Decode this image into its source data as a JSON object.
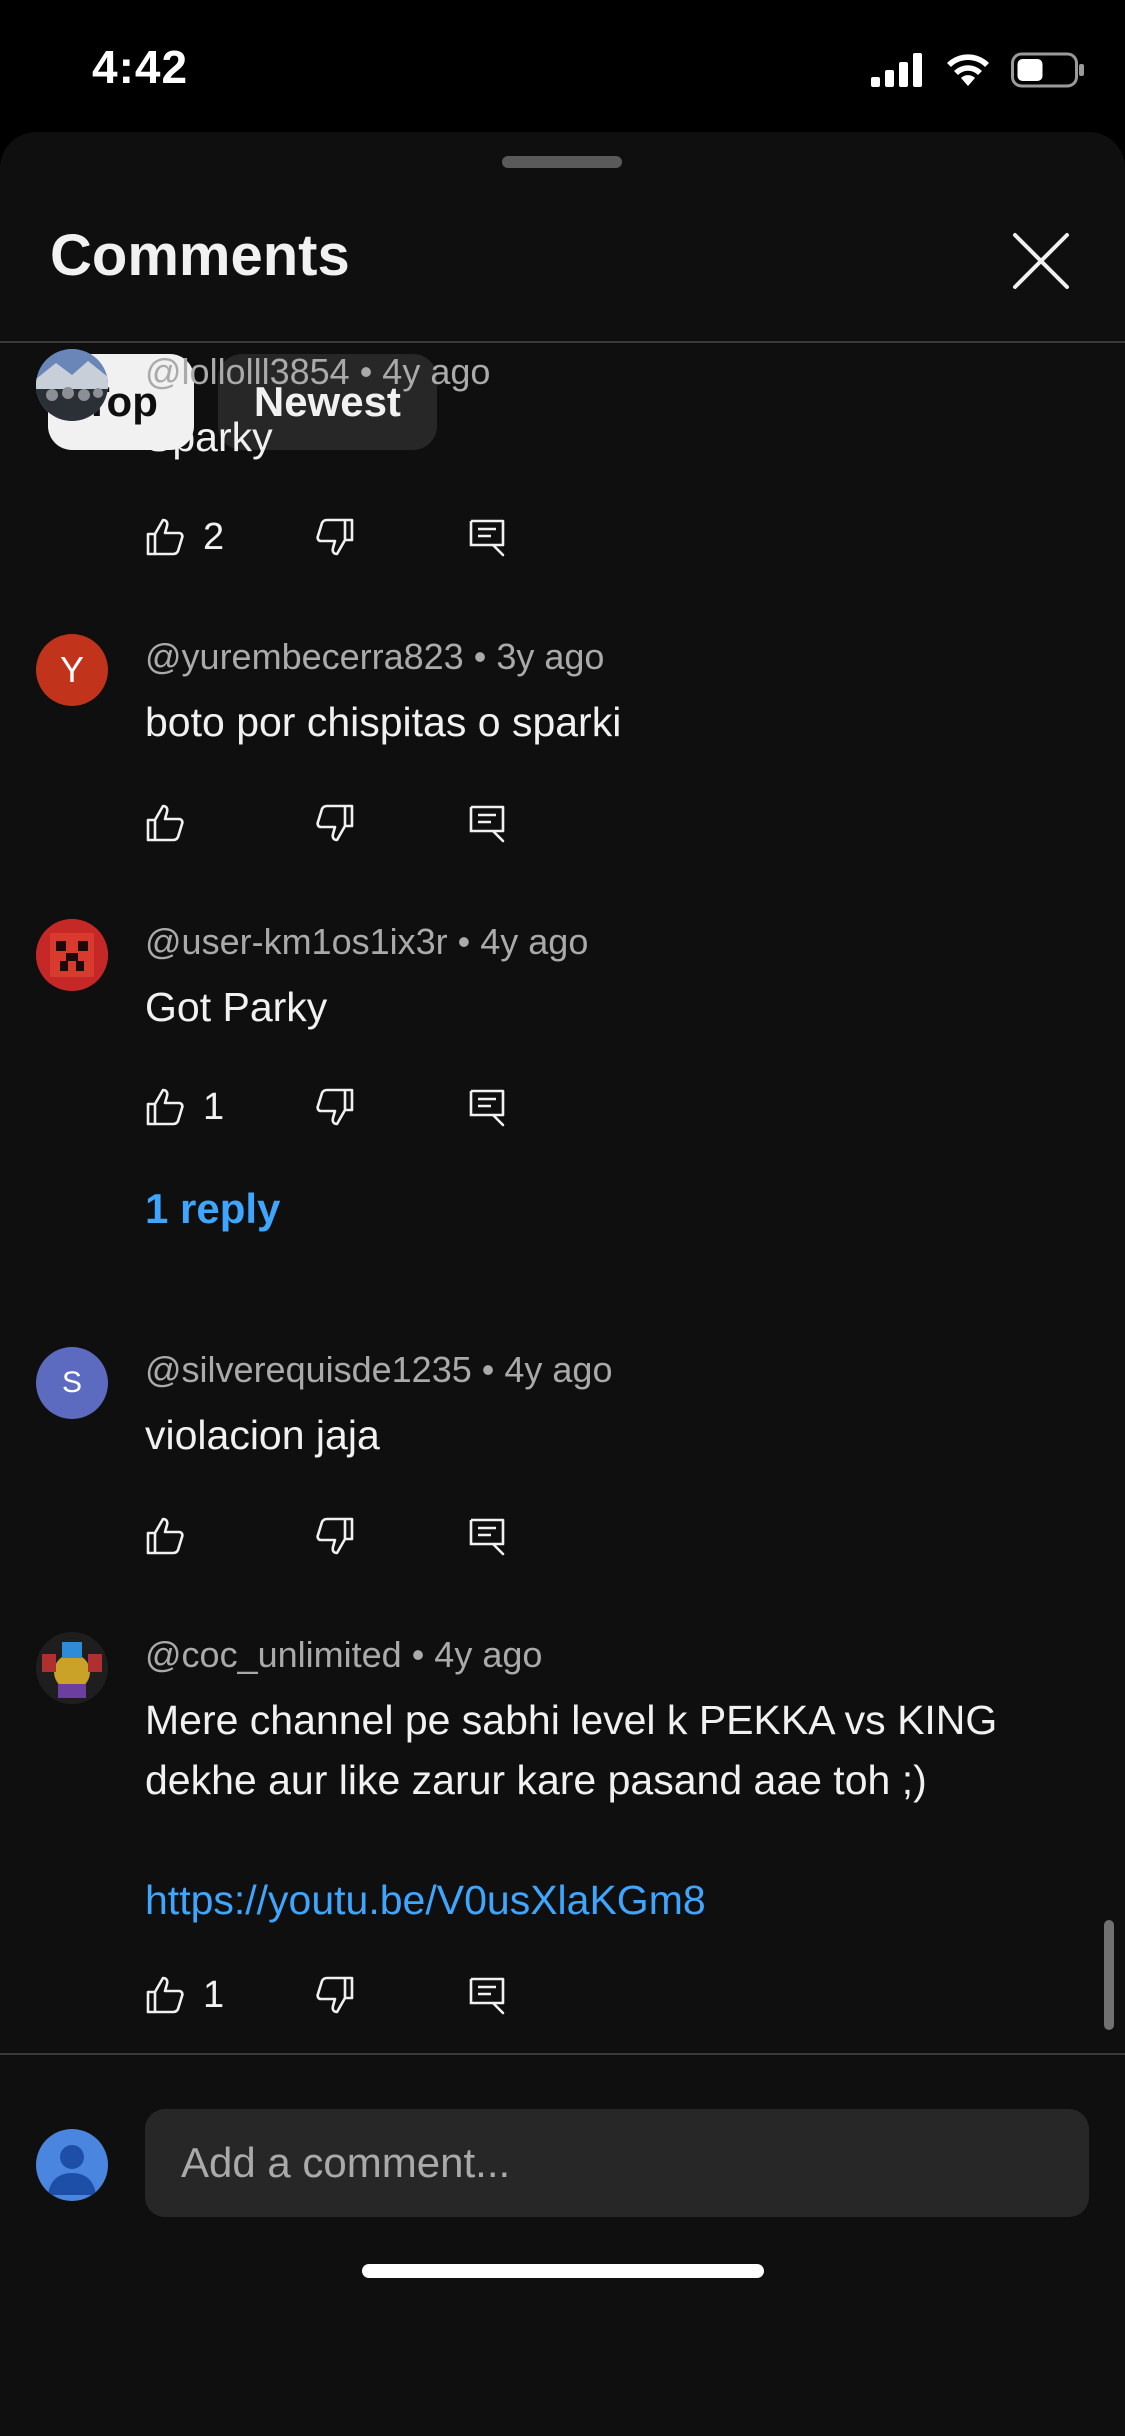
{
  "status": {
    "time": "4:42"
  },
  "sheet": {
    "title": "Comments",
    "tabs": [
      {
        "label": "Top",
        "active": true
      },
      {
        "label": "Newest",
        "active": false
      }
    ]
  },
  "comments": [
    {
      "handle": "@lollolll3854",
      "age": "4y ago",
      "text": "Sparky",
      "likes": "2",
      "avatar": "image"
    },
    {
      "handle": "@yurembecerra823",
      "age": "3y ago",
      "text": "boto por chispitas o sparki",
      "likes": "",
      "avatar_letter": "Y",
      "avatar_color": "#c1341b"
    },
    {
      "handle": "@user-km1os1ix3r",
      "age": "4y ago",
      "text": "Got Parky",
      "likes": "1",
      "replies": "1 reply",
      "avatar": "image"
    },
    {
      "handle": "@silverequisde1235",
      "age": "4y ago",
      "text": "violacion jaja",
      "likes": "",
      "avatar_letter": "S",
      "avatar_color": "#5c6bc0"
    },
    {
      "handle": "@coc_unlimited",
      "age": "4y ago",
      "text": "Mere channel pe sabhi level k PEKKA vs KING dekhe aur like zarur kare pasand aae toh ;)",
      "link": "https://youtu.be/V0usXlaKGm8",
      "likes": "1",
      "avatar": "image"
    }
  ],
  "composer": {
    "placeholder": "Add a comment..."
  },
  "colors": {
    "accent_link": "#3ea6ff",
    "background": "#0f0f0f",
    "chip_active": "#f1f1f1",
    "chip_inactive": "#272727"
  }
}
